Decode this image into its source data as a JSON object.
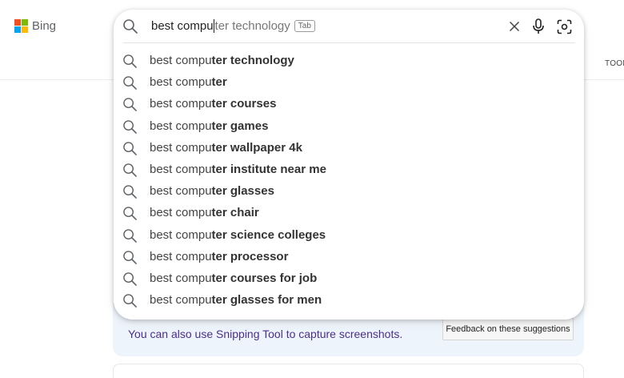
{
  "brand": {
    "name": "Bing",
    "logo_colors": [
      "#f25022",
      "#7fba00",
      "#00a4ef",
      "#ffb900"
    ]
  },
  "nav": {
    "tools_label": "TOOL"
  },
  "search": {
    "typed": "best compu",
    "ghost_completion": "ter technology",
    "tab_hint": "Tab",
    "icons": {
      "search": "search-icon",
      "clear": "close-icon",
      "mic": "microphone-icon",
      "visual": "visual-search-icon"
    }
  },
  "suggestions": [
    {
      "prefix": "best compu",
      "rest": "ter technology"
    },
    {
      "prefix": "best compu",
      "rest": "ter"
    },
    {
      "prefix": "best compu",
      "rest": "ter courses"
    },
    {
      "prefix": "best compu",
      "rest": "ter games"
    },
    {
      "prefix": "best compu",
      "rest": "ter wallpaper 4k"
    },
    {
      "prefix": "best compu",
      "rest": "ter institute near me"
    },
    {
      "prefix": "best compu",
      "rest": "ter glasses"
    },
    {
      "prefix": "best compu",
      "rest": "ter chair"
    },
    {
      "prefix": "best compu",
      "rest": "ter science colleges"
    },
    {
      "prefix": "best compu",
      "rest": "ter processor"
    },
    {
      "prefix": "best compu",
      "rest": "ter courses for job"
    },
    {
      "prefix": "best compu",
      "rest": "ter glasses for men"
    }
  ],
  "hint": {
    "text": "You can also use Snipping Tool to capture screenshots.",
    "feedback_label": "Feedback on these suggestions"
  },
  "colors": {
    "hint_bg": "#eef4fb",
    "hint_text": "#4b2f8f"
  }
}
